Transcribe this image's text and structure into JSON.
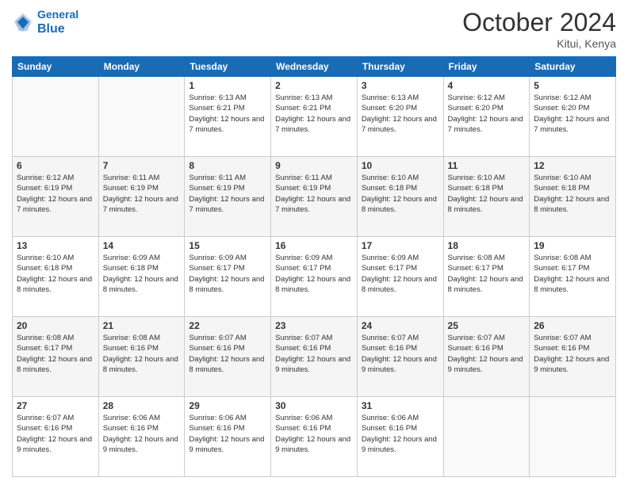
{
  "header": {
    "logo_line1": "General",
    "logo_line2": "Blue",
    "month": "October 2024",
    "location": "Kitui, Kenya"
  },
  "days_of_week": [
    "Sunday",
    "Monday",
    "Tuesday",
    "Wednesday",
    "Thursday",
    "Friday",
    "Saturday"
  ],
  "weeks": [
    [
      {
        "day": "",
        "sunrise": "",
        "sunset": "",
        "daylight": ""
      },
      {
        "day": "",
        "sunrise": "",
        "sunset": "",
        "daylight": ""
      },
      {
        "day": "1",
        "sunrise": "Sunrise: 6:13 AM",
        "sunset": "Sunset: 6:21 PM",
        "daylight": "Daylight: 12 hours and 7 minutes."
      },
      {
        "day": "2",
        "sunrise": "Sunrise: 6:13 AM",
        "sunset": "Sunset: 6:21 PM",
        "daylight": "Daylight: 12 hours and 7 minutes."
      },
      {
        "day": "3",
        "sunrise": "Sunrise: 6:13 AM",
        "sunset": "Sunset: 6:20 PM",
        "daylight": "Daylight: 12 hours and 7 minutes."
      },
      {
        "day": "4",
        "sunrise": "Sunrise: 6:12 AM",
        "sunset": "Sunset: 6:20 PM",
        "daylight": "Daylight: 12 hours and 7 minutes."
      },
      {
        "day": "5",
        "sunrise": "Sunrise: 6:12 AM",
        "sunset": "Sunset: 6:20 PM",
        "daylight": "Daylight: 12 hours and 7 minutes."
      }
    ],
    [
      {
        "day": "6",
        "sunrise": "Sunrise: 6:12 AM",
        "sunset": "Sunset: 6:19 PM",
        "daylight": "Daylight: 12 hours and 7 minutes."
      },
      {
        "day": "7",
        "sunrise": "Sunrise: 6:11 AM",
        "sunset": "Sunset: 6:19 PM",
        "daylight": "Daylight: 12 hours and 7 minutes."
      },
      {
        "day": "8",
        "sunrise": "Sunrise: 6:11 AM",
        "sunset": "Sunset: 6:19 PM",
        "daylight": "Daylight: 12 hours and 7 minutes."
      },
      {
        "day": "9",
        "sunrise": "Sunrise: 6:11 AM",
        "sunset": "Sunset: 6:19 PM",
        "daylight": "Daylight: 12 hours and 7 minutes."
      },
      {
        "day": "10",
        "sunrise": "Sunrise: 6:10 AM",
        "sunset": "Sunset: 6:18 PM",
        "daylight": "Daylight: 12 hours and 8 minutes."
      },
      {
        "day": "11",
        "sunrise": "Sunrise: 6:10 AM",
        "sunset": "Sunset: 6:18 PM",
        "daylight": "Daylight: 12 hours and 8 minutes."
      },
      {
        "day": "12",
        "sunrise": "Sunrise: 6:10 AM",
        "sunset": "Sunset: 6:18 PM",
        "daylight": "Daylight: 12 hours and 8 minutes."
      }
    ],
    [
      {
        "day": "13",
        "sunrise": "Sunrise: 6:10 AM",
        "sunset": "Sunset: 6:18 PM",
        "daylight": "Daylight: 12 hours and 8 minutes."
      },
      {
        "day": "14",
        "sunrise": "Sunrise: 6:09 AM",
        "sunset": "Sunset: 6:18 PM",
        "daylight": "Daylight: 12 hours and 8 minutes."
      },
      {
        "day": "15",
        "sunrise": "Sunrise: 6:09 AM",
        "sunset": "Sunset: 6:17 PM",
        "daylight": "Daylight: 12 hours and 8 minutes."
      },
      {
        "day": "16",
        "sunrise": "Sunrise: 6:09 AM",
        "sunset": "Sunset: 6:17 PM",
        "daylight": "Daylight: 12 hours and 8 minutes."
      },
      {
        "day": "17",
        "sunrise": "Sunrise: 6:09 AM",
        "sunset": "Sunset: 6:17 PM",
        "daylight": "Daylight: 12 hours and 8 minutes."
      },
      {
        "day": "18",
        "sunrise": "Sunrise: 6:08 AM",
        "sunset": "Sunset: 6:17 PM",
        "daylight": "Daylight: 12 hours and 8 minutes."
      },
      {
        "day": "19",
        "sunrise": "Sunrise: 6:08 AM",
        "sunset": "Sunset: 6:17 PM",
        "daylight": "Daylight: 12 hours and 8 minutes."
      }
    ],
    [
      {
        "day": "20",
        "sunrise": "Sunrise: 6:08 AM",
        "sunset": "Sunset: 6:17 PM",
        "daylight": "Daylight: 12 hours and 8 minutes."
      },
      {
        "day": "21",
        "sunrise": "Sunrise: 6:08 AM",
        "sunset": "Sunset: 6:16 PM",
        "daylight": "Daylight: 12 hours and 8 minutes."
      },
      {
        "day": "22",
        "sunrise": "Sunrise: 6:07 AM",
        "sunset": "Sunset: 6:16 PM",
        "daylight": "Daylight: 12 hours and 8 minutes."
      },
      {
        "day": "23",
        "sunrise": "Sunrise: 6:07 AM",
        "sunset": "Sunset: 6:16 PM",
        "daylight": "Daylight: 12 hours and 9 minutes."
      },
      {
        "day": "24",
        "sunrise": "Sunrise: 6:07 AM",
        "sunset": "Sunset: 6:16 PM",
        "daylight": "Daylight: 12 hours and 9 minutes."
      },
      {
        "day": "25",
        "sunrise": "Sunrise: 6:07 AM",
        "sunset": "Sunset: 6:16 PM",
        "daylight": "Daylight: 12 hours and 9 minutes."
      },
      {
        "day": "26",
        "sunrise": "Sunrise: 6:07 AM",
        "sunset": "Sunset: 6:16 PM",
        "daylight": "Daylight: 12 hours and 9 minutes."
      }
    ],
    [
      {
        "day": "27",
        "sunrise": "Sunrise: 6:07 AM",
        "sunset": "Sunset: 6:16 PM",
        "daylight": "Daylight: 12 hours and 9 minutes."
      },
      {
        "day": "28",
        "sunrise": "Sunrise: 6:06 AM",
        "sunset": "Sunset: 6:16 PM",
        "daylight": "Daylight: 12 hours and 9 minutes."
      },
      {
        "day": "29",
        "sunrise": "Sunrise: 6:06 AM",
        "sunset": "Sunset: 6:16 PM",
        "daylight": "Daylight: 12 hours and 9 minutes."
      },
      {
        "day": "30",
        "sunrise": "Sunrise: 6:06 AM",
        "sunset": "Sunset: 6:16 PM",
        "daylight": "Daylight: 12 hours and 9 minutes."
      },
      {
        "day": "31",
        "sunrise": "Sunrise: 6:06 AM",
        "sunset": "Sunset: 6:16 PM",
        "daylight": "Daylight: 12 hours and 9 minutes."
      },
      {
        "day": "",
        "sunrise": "",
        "sunset": "",
        "daylight": ""
      },
      {
        "day": "",
        "sunrise": "",
        "sunset": "",
        "daylight": ""
      }
    ]
  ]
}
